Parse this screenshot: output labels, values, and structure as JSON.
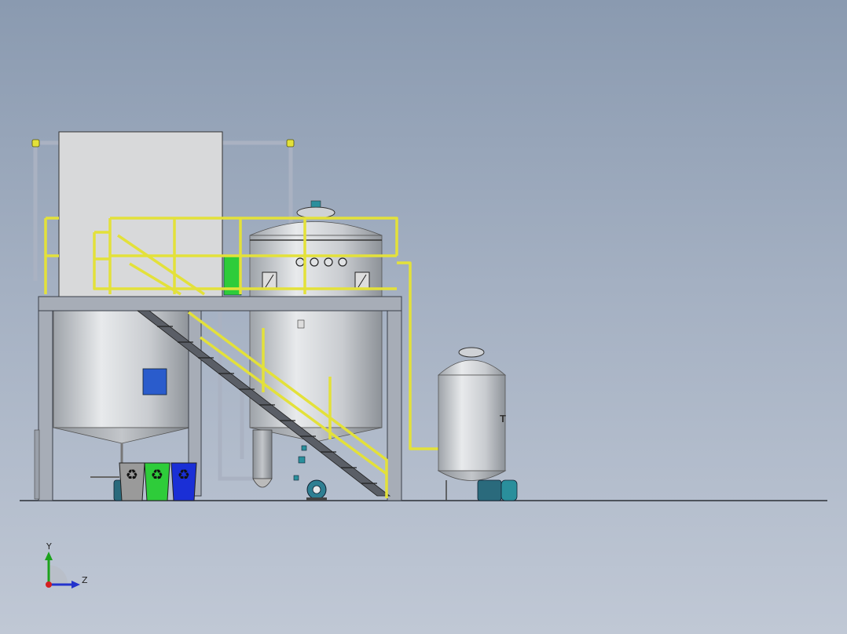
{
  "viewport": {
    "background_top": "#8a9ab0",
    "background_bottom": "#c0c8d5"
  },
  "model": {
    "tank_marking": "T",
    "colors": {
      "railing": "#e3e13a",
      "frame": "#9aa0ac",
      "tank_metal": "#cfd2d6",
      "cabinet": "#d8d9da",
      "panel_blue": "#2a5ccc",
      "bin_grey": "#9a9a9a",
      "bin_green": "#2ecc3a",
      "bin_blue": "#1a2fd6",
      "pump_teal": "#2a8f9c"
    },
    "icons": [
      "recycle-icon",
      "recycle-icon",
      "recycle-icon"
    ]
  },
  "triad": {
    "y_label": "Y",
    "z_label": "Z"
  }
}
